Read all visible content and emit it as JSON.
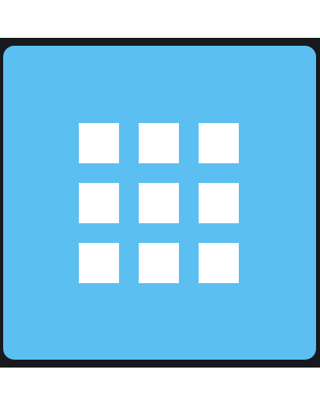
{
  "icon": {
    "name": "app-grid-icon",
    "tile_color": "#5bbff1",
    "frame_color": "#17191c",
    "square_color": "#ffffff",
    "grid": {
      "rows": 3,
      "columns": 3
    }
  }
}
